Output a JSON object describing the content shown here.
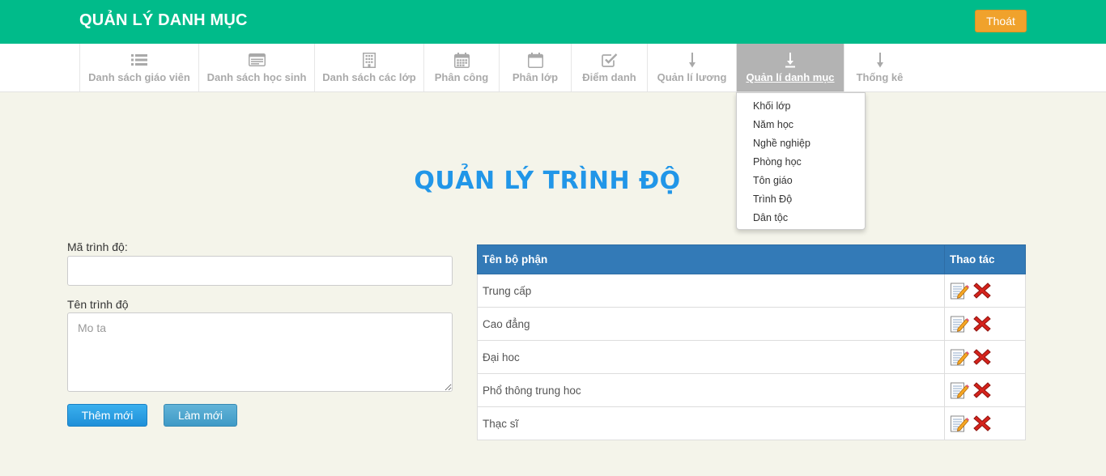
{
  "header": {
    "title": "QUẢN LÝ DANH MỤC",
    "logout_label": "Thoát"
  },
  "nav": {
    "items": [
      {
        "label": "Danh sách giáo viên",
        "icon": "list-icon"
      },
      {
        "label": "Danh sách học sinh",
        "icon": "id-card-icon"
      },
      {
        "label": "Danh sách các lớp",
        "icon": "building-icon"
      },
      {
        "label": "Phân công",
        "icon": "calendar-icon"
      },
      {
        "label": "Phân lớp",
        "icon": "calendar-blank-icon"
      },
      {
        "label": "Điểm danh",
        "icon": "check-square-icon"
      },
      {
        "label": "Quản lí lương",
        "icon": "arrow-down-icon"
      },
      {
        "label": "Quản lí danh mục",
        "icon": "download-icon"
      },
      {
        "label": "Thống kê",
        "icon": "arrow-down-icon"
      }
    ],
    "active": "Quản lí danh mục"
  },
  "dropdown": {
    "items": [
      "Khối lớp",
      "Năm học",
      "Nghề nghiệp",
      "Phòng học",
      "Tôn giáo",
      "Trình Độ",
      "Dân tộc"
    ]
  },
  "main": {
    "title": "QUẢN LÝ TRÌNH ĐỘ",
    "form": {
      "code_label": "Mã trình độ:",
      "code_value": "",
      "name_label": "Tên trình độ",
      "name_placeholder": "Mo ta",
      "add_label": "Thêm mới",
      "reset_label": "Làm mới"
    },
    "table": {
      "headers": [
        "Tên bộ phận",
        "Thao tác"
      ],
      "rows": [
        "Trung cấp",
        "Cao đẳng",
        "Đại hoc",
        "Phổ thông trung hoc",
        "Thạc sĩ"
      ]
    }
  },
  "colors": {
    "header_bg": "#00bb8a",
    "logout_bg": "#f0a22c",
    "title": "#2196e8",
    "table_head": "#337ab7",
    "active_nav": "#b3b3b3"
  }
}
